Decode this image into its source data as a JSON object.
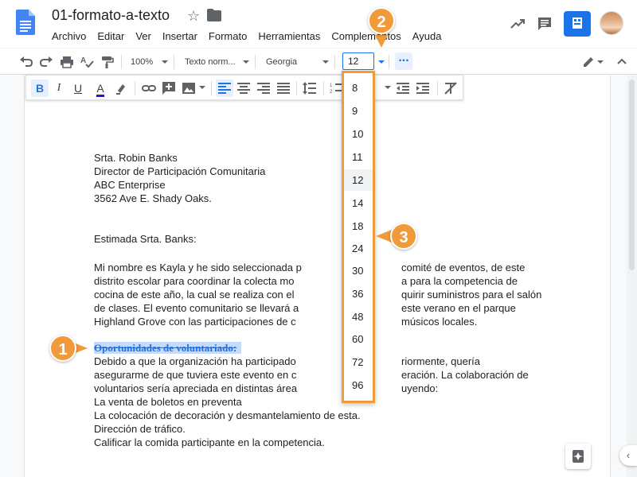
{
  "doc": {
    "title": "01-formato-a-texto"
  },
  "menu": [
    "Archivo",
    "Editar",
    "Ver",
    "Insertar",
    "Formato",
    "Herramientas",
    "Complementos",
    "Ayuda"
  ],
  "toolbar": {
    "zoom": "100%",
    "style": "Texto norm...",
    "font": "Georgia",
    "font_size": "12",
    "more": "..."
  },
  "font_sizes": [
    "8",
    "9",
    "10",
    "11",
    "12",
    "14",
    "18",
    "24",
    "30",
    "36",
    "48",
    "60",
    "72",
    "96"
  ],
  "selected_font_size": "12",
  "letter": {
    "address": [
      "Srta. Robin Banks",
      "Director de Participación Comunitaria",
      "ABC Enterprise",
      "3562 Ave E. Shady Oaks."
    ],
    "greeting": "Estimada Srta. Banks:",
    "paragraph1": [
      "Mi nombre es Kayla y he sido seleccionada p",
      "comité de eventos, de este",
      "distrito escolar para coordinar la colecta mo",
      "a para la competencia de",
      "cocina de este año, la cual se realiza con el",
      "quirir suministros para el salón",
      "de clases. El evento comunitario se llevará a",
      "este verano en el parque",
      "Highland Grove con las participaciones de c",
      "músicos locales."
    ],
    "heading": "Oportunidades de voluntariado:",
    "paragraph2": [
      "Debido a que la organización ha participado",
      "riormente, quería",
      "asegurarme de que tuviera este evento en c",
      "eración. La colaboración de",
      "voluntarios sería apreciada en distintas área",
      "uyendo:"
    ],
    "list": [
      "La venta de boletos en preventa",
      "La colocación de decoración y desmantelamiento de esta.",
      "Dirección de tráfico.",
      "Calificar la comida participante en la competencia."
    ]
  },
  "callouts": [
    "1",
    "2",
    "3"
  ],
  "colors": {
    "accent": "#1a73e8",
    "callout": "#f19a3a",
    "highlight": "#c6dafc"
  }
}
